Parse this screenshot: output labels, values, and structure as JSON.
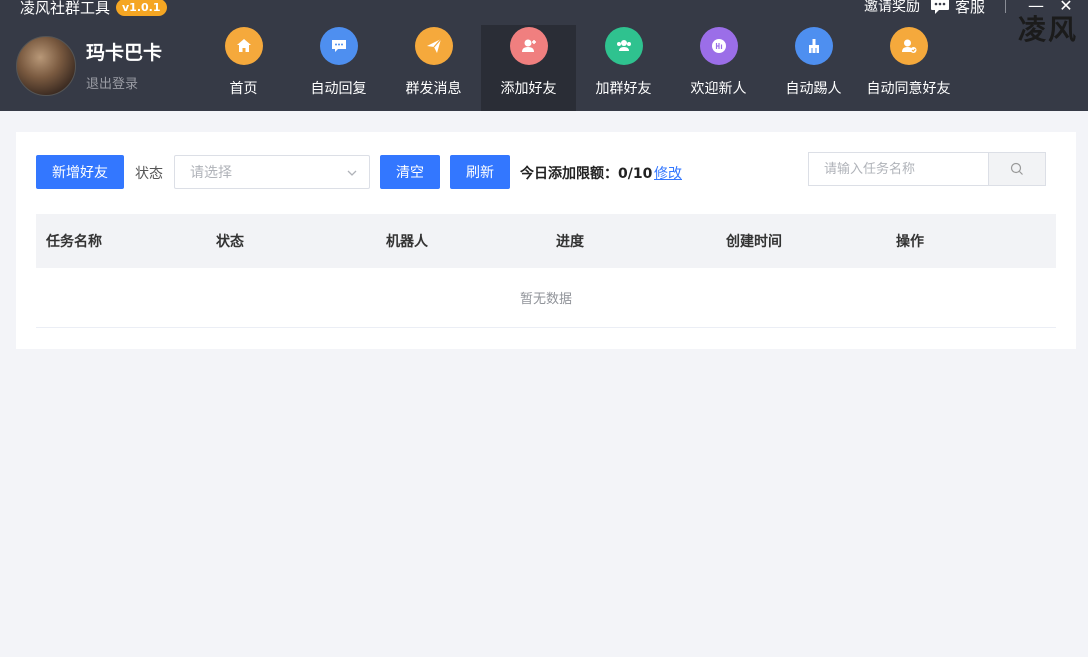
{
  "app": {
    "title": "凌风社群工具",
    "version": "v1.0.1"
  },
  "topbar": {
    "invite": "邀请奖励",
    "service": "客服",
    "minimize": "—",
    "close": "✕",
    "watermark": "凌风"
  },
  "user": {
    "name": "玛卡巴卡",
    "logout": "退出登录"
  },
  "nav": {
    "items": [
      {
        "label": "首页",
        "color": "#f5a93c",
        "icon": "home-icon"
      },
      {
        "label": "自动回复",
        "color": "#4e8ff0",
        "icon": "chat-icon"
      },
      {
        "label": "群发消息",
        "color": "#f5a93c",
        "icon": "send-icon"
      },
      {
        "label": "添加好友",
        "color": "#f07f7f",
        "icon": "add-user-icon"
      },
      {
        "label": "加群好友",
        "color": "#2fc28f",
        "icon": "group-icon"
      },
      {
        "label": "欢迎新人",
        "color": "#9b6ee8",
        "icon": "hi-icon"
      },
      {
        "label": "自动踢人",
        "color": "#4e8ff0",
        "icon": "broom-icon"
      },
      {
        "label": "自动同意好友",
        "color": "#f5a93c",
        "icon": "user-check-icon"
      }
    ],
    "active": "添加好友"
  },
  "toolbar": {
    "add_button": "新增好友",
    "status_label": "状态",
    "status_placeholder": "请选择",
    "clear_button": "清空",
    "refresh_button": "刷新",
    "limit_label": "今日添加限额：",
    "limit_value": "0/10",
    "modify_link": "修改",
    "search_placeholder": "请输入任务名称"
  },
  "table": {
    "columns": [
      "任务名称",
      "状态",
      "机器人",
      "进度",
      "创建时间",
      "操作"
    ],
    "rows": [],
    "empty_text": "暂无数据"
  },
  "colors": {
    "header_bg": "#363a46",
    "primary": "#3377ff",
    "page_bg": "#f3f4f8"
  }
}
